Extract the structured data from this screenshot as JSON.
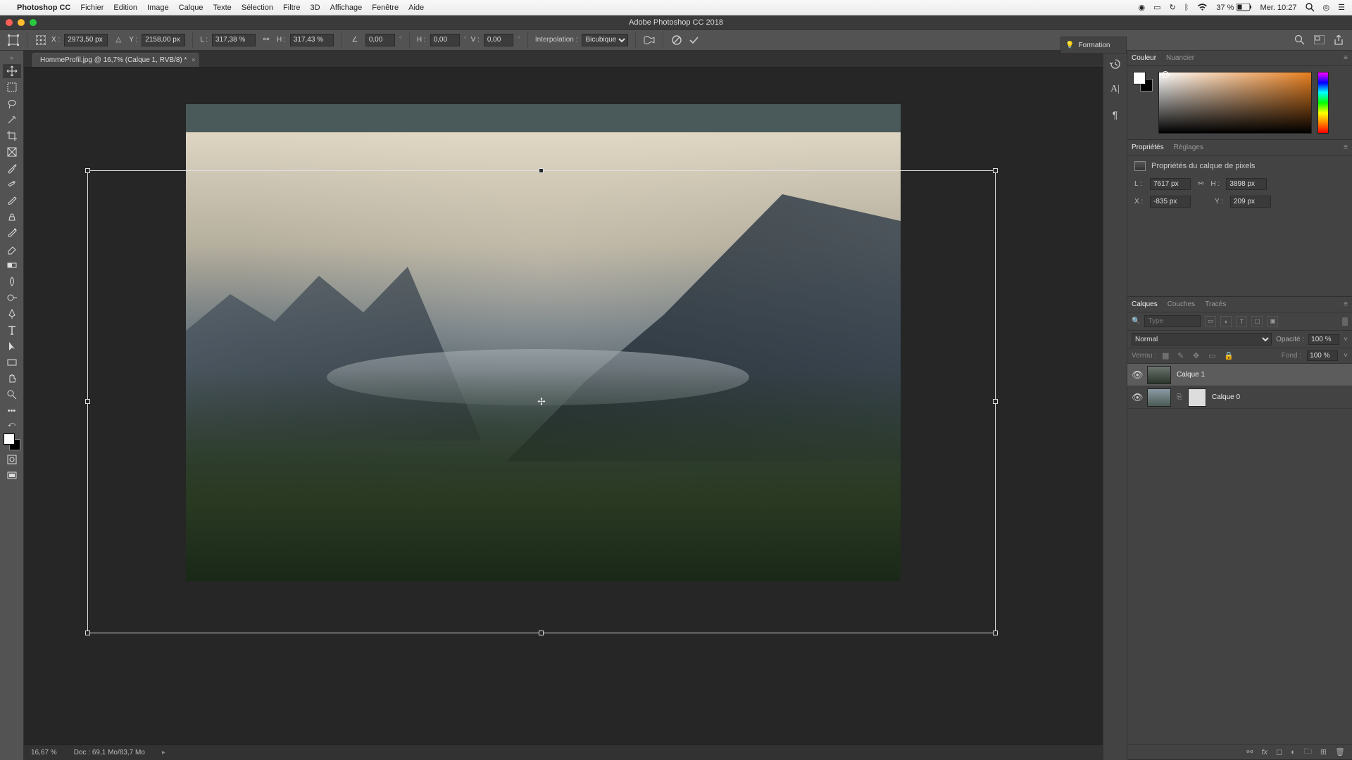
{
  "mac_menubar": {
    "app_name": "Photoshop CC",
    "items": [
      "Fichier",
      "Edition",
      "Image",
      "Calque",
      "Texte",
      "Sélection",
      "Filtre",
      "3D",
      "Affichage",
      "Fenêtre",
      "Aide"
    ],
    "battery": "37 %",
    "datetime": "Mer. 10:27"
  },
  "window_title": "Adobe Photoshop CC 2018",
  "document_tab": "HommeProfil.jpg @ 16,7% (Calque 1, RVB/8) *",
  "options_bar": {
    "x_label": "X :",
    "x_value": "2973,50 px",
    "y_label": "Y :",
    "y_value": "2158,00 px",
    "l_label": "L :",
    "l_value": "317,38 %",
    "h_label": "H :",
    "h_value": "317,43 %",
    "angle_label": "",
    "angle_value": "0,00",
    "h2_label": "H :",
    "h2_value": "0,00",
    "v_label": "V :",
    "v_value": "0,00",
    "interp_label": "Interpolation :",
    "interp_value": "Bicubique"
  },
  "status_bar": {
    "zoom": "16,67 %",
    "doc_info": "Doc : 69,1 Mo/83,7 Mo"
  },
  "panels": {
    "formation": "Formation",
    "couleur_tabs": {
      "couleur": "Couleur",
      "nuancier": "Nuancier"
    },
    "props_tabs": {
      "props": "Propriétés",
      "reglages": "Réglages"
    },
    "props_title": "Propriétés du calque de pixels",
    "props": {
      "l_label": "L :",
      "l_value": "7617 px",
      "h_label": "H :",
      "h_value": "3898 px",
      "x_label": "X :",
      "x_value": "-835 px",
      "y_label": "Y :",
      "y_value": "209 px"
    },
    "layers_tabs": {
      "calques": "Calques",
      "couches": "Couches",
      "traces": "Tracés"
    },
    "layers": {
      "filter_placeholder": "Type",
      "blend_mode": "Normal",
      "opacity_label": "Opacité :",
      "opacity_value": "100 %",
      "lock_label": "Verrou :",
      "fill_label": "Fond :",
      "fill_value": "100 %",
      "items": [
        {
          "name": "Calque 1"
        },
        {
          "name": "Calque 0"
        }
      ]
    }
  }
}
